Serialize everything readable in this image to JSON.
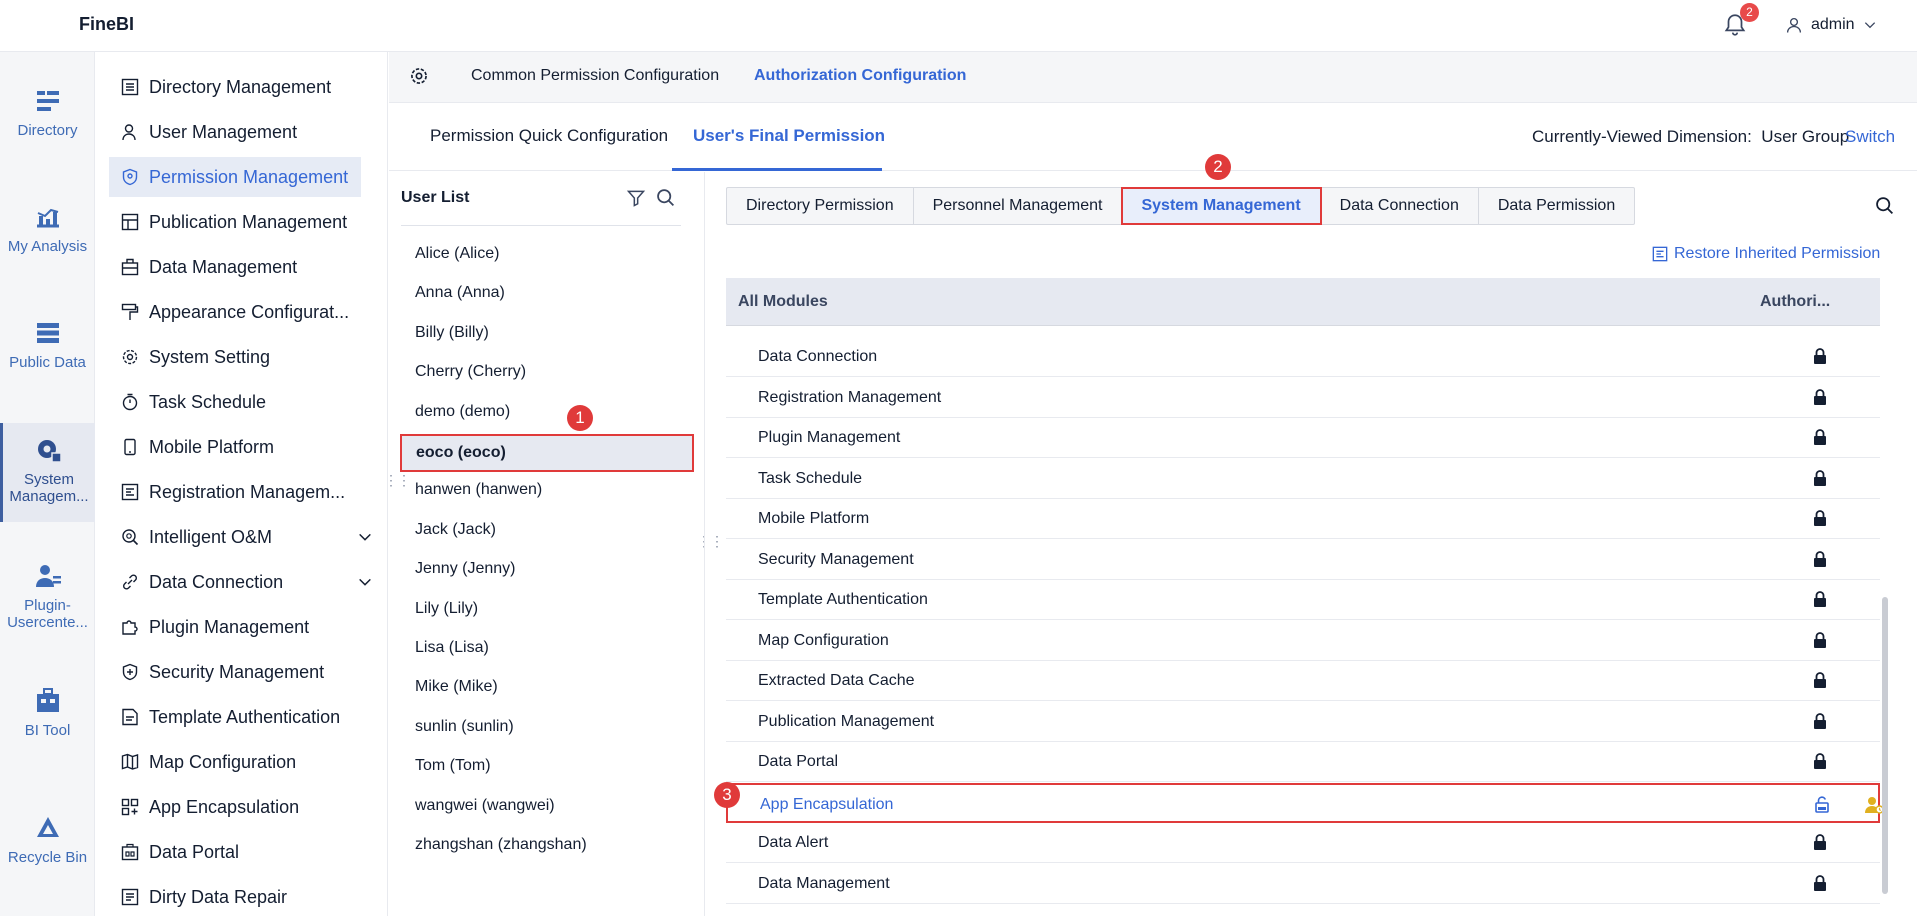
{
  "app": {
    "logo": "FineBI",
    "notification_count": "2",
    "username": "admin"
  },
  "leftnav": [
    {
      "label": "Directory",
      "icon": "directory-icon"
    },
    {
      "label": "My Analysis",
      "icon": "analysis-icon"
    },
    {
      "label": "Public Data",
      "icon": "public-data-icon"
    },
    {
      "label": "System Managem...",
      "icon": "system-management-icon",
      "active": true
    },
    {
      "label": "Plugin-Usercente...",
      "icon": "plugin-usercenter-icon"
    },
    {
      "label": "BI Tool",
      "icon": "bi-tool-icon"
    },
    {
      "label": "Recycle Bin",
      "icon": "recycle-bin-icon"
    }
  ],
  "menu": [
    {
      "label": "Directory Management"
    },
    {
      "label": "User Management"
    },
    {
      "label": "Permission Management",
      "active": true
    },
    {
      "label": "Publication Management"
    },
    {
      "label": "Data Management"
    },
    {
      "label": "Appearance Configurat..."
    },
    {
      "label": "System Setting"
    },
    {
      "label": "Task Schedule"
    },
    {
      "label": "Mobile Platform"
    },
    {
      "label": "Registration Managem..."
    },
    {
      "label": "Intelligent O&M",
      "expandable": true
    },
    {
      "label": "Data Connection",
      "expandable": true
    },
    {
      "label": "Plugin Management"
    },
    {
      "label": "Security Management"
    },
    {
      "label": "Template Authentication"
    },
    {
      "label": "Map Configuration"
    },
    {
      "label": "App Encapsulation"
    },
    {
      "label": "Data Portal"
    },
    {
      "label": "Dirty Data Repair"
    }
  ],
  "subtop": {
    "common": "Common Permission Configuration",
    "auth": "Authorization Configuration"
  },
  "tabs": {
    "quick": "Permission Quick Configuration",
    "final": "User's Final Permission"
  },
  "dimension": {
    "label": "Currently-Viewed Dimension:",
    "value": "User Group",
    "switch": "Switch"
  },
  "userlist": {
    "title": "User List",
    "users": [
      "Alice (Alice)",
      "Anna (Anna)",
      "Billy (Billy)",
      "Cherry (Cherry)",
      "demo (demo)",
      "eoco (eoco)",
      "hanwen (hanwen)",
      "Jack (Jack)",
      "Jenny (Jenny)",
      "Lily (Lily)",
      "Lisa (Lisa)",
      "Mike (Mike)",
      "sunlin (sunlin)",
      "Tom (Tom)",
      "wangwei (wangwei)",
      "zhangshan (zhangshan)"
    ],
    "selected_index": 5
  },
  "perm_tabs": [
    "Directory Permission",
    "Personnel Management",
    "System Management",
    "Data Connection",
    "Data Permission"
  ],
  "perm_tab_active": "System Management",
  "restore": "Restore Inherited Permission",
  "table": {
    "col_modules": "All Modules",
    "col_auth": "Authori...",
    "rows": [
      {
        "name": "Data Connection",
        "locked": true
      },
      {
        "name": "Registration Management",
        "locked": true
      },
      {
        "name": "Plugin Management",
        "locked": true
      },
      {
        "name": "Task Schedule",
        "locked": true
      },
      {
        "name": "Mobile Platform",
        "locked": true
      },
      {
        "name": "Security Management",
        "locked": true
      },
      {
        "name": "Template Authentication",
        "locked": true
      },
      {
        "name": "Map Configuration",
        "locked": true
      },
      {
        "name": "Extracted Data Cache",
        "locked": true
      },
      {
        "name": "Publication Management",
        "locked": true
      },
      {
        "name": "Data Portal",
        "locked": true
      },
      {
        "name": "App Encapsulation",
        "locked": false,
        "highlighted": true
      },
      {
        "name": "Data Alert",
        "locked": true
      },
      {
        "name": "Data Management",
        "locked": true
      }
    ]
  },
  "markers": [
    "1",
    "2",
    "3"
  ],
  "colors": {
    "accent": "#3567d5",
    "highlight": "#e03a3a",
    "nav_icon": "#3e6bb5",
    "role_icon": "#e0b020"
  }
}
